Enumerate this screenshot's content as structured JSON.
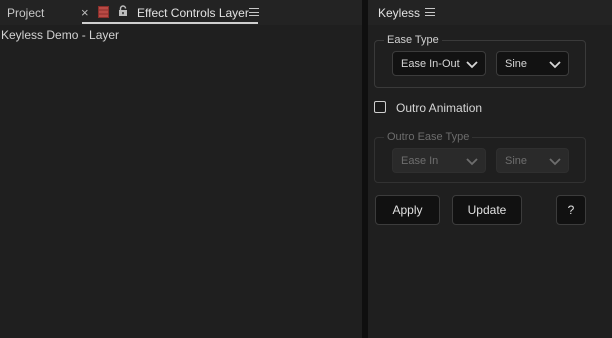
{
  "tabs": {
    "project": "Project",
    "close": "×",
    "effect_controls": "Effect Controls Layer",
    "keyless": "Keyless"
  },
  "left_panel": {
    "title": "Keyless Demo - Layer"
  },
  "keyless_panel": {
    "ease_type": {
      "legend": "Ease Type",
      "ease_value": "Ease In-Out",
      "curve_value": "Sine"
    },
    "outro_checkbox": {
      "label": "Outro Animation",
      "checked": false
    },
    "outro_ease_type": {
      "legend": "Outro Ease Type",
      "ease_value": "Ease In",
      "curve_value": "Sine"
    },
    "buttons": {
      "apply": "Apply",
      "update": "Update",
      "help": "?"
    }
  },
  "colors": {
    "lock_icon": "#b84a45",
    "accent_underline": "#cfcfcf"
  }
}
